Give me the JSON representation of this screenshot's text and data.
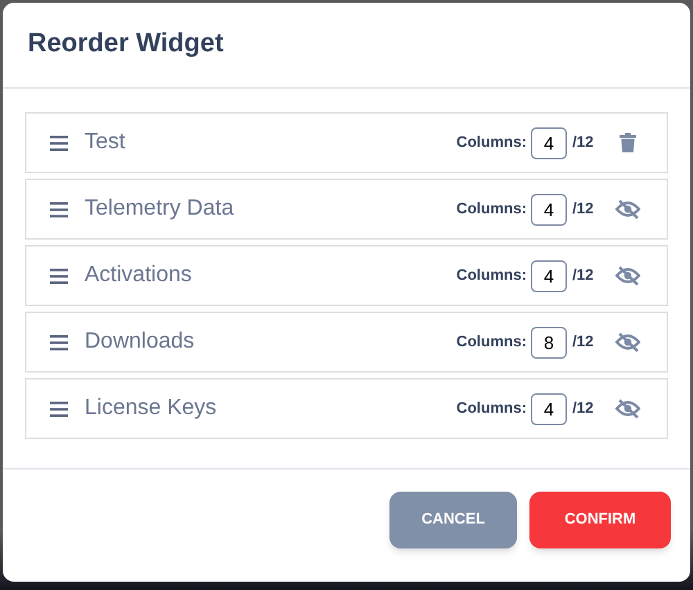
{
  "dialog": {
    "title": "Reorder Widget"
  },
  "widgets": [
    {
      "name": "Test",
      "columns_label": "Columns:",
      "columns": "4",
      "max": "/12",
      "kind": "delete"
    },
    {
      "name": "Telemetry Data",
      "columns_label": "Columns:",
      "columns": "4",
      "max": "/12",
      "kind": "hidden"
    },
    {
      "name": "Activations",
      "columns_label": "Columns:",
      "columns": "4",
      "max": "/12",
      "kind": "hidden"
    },
    {
      "name": "Downloads",
      "columns_label": "Columns:",
      "columns": "8",
      "max": "/12",
      "kind": "hidden"
    },
    {
      "name": "License Keys",
      "columns_label": "Columns:",
      "columns": "4",
      "max": "/12",
      "kind": "hidden"
    }
  ],
  "buttons": {
    "cancel": "CANCEL",
    "confirm": "CONFIRM"
  }
}
